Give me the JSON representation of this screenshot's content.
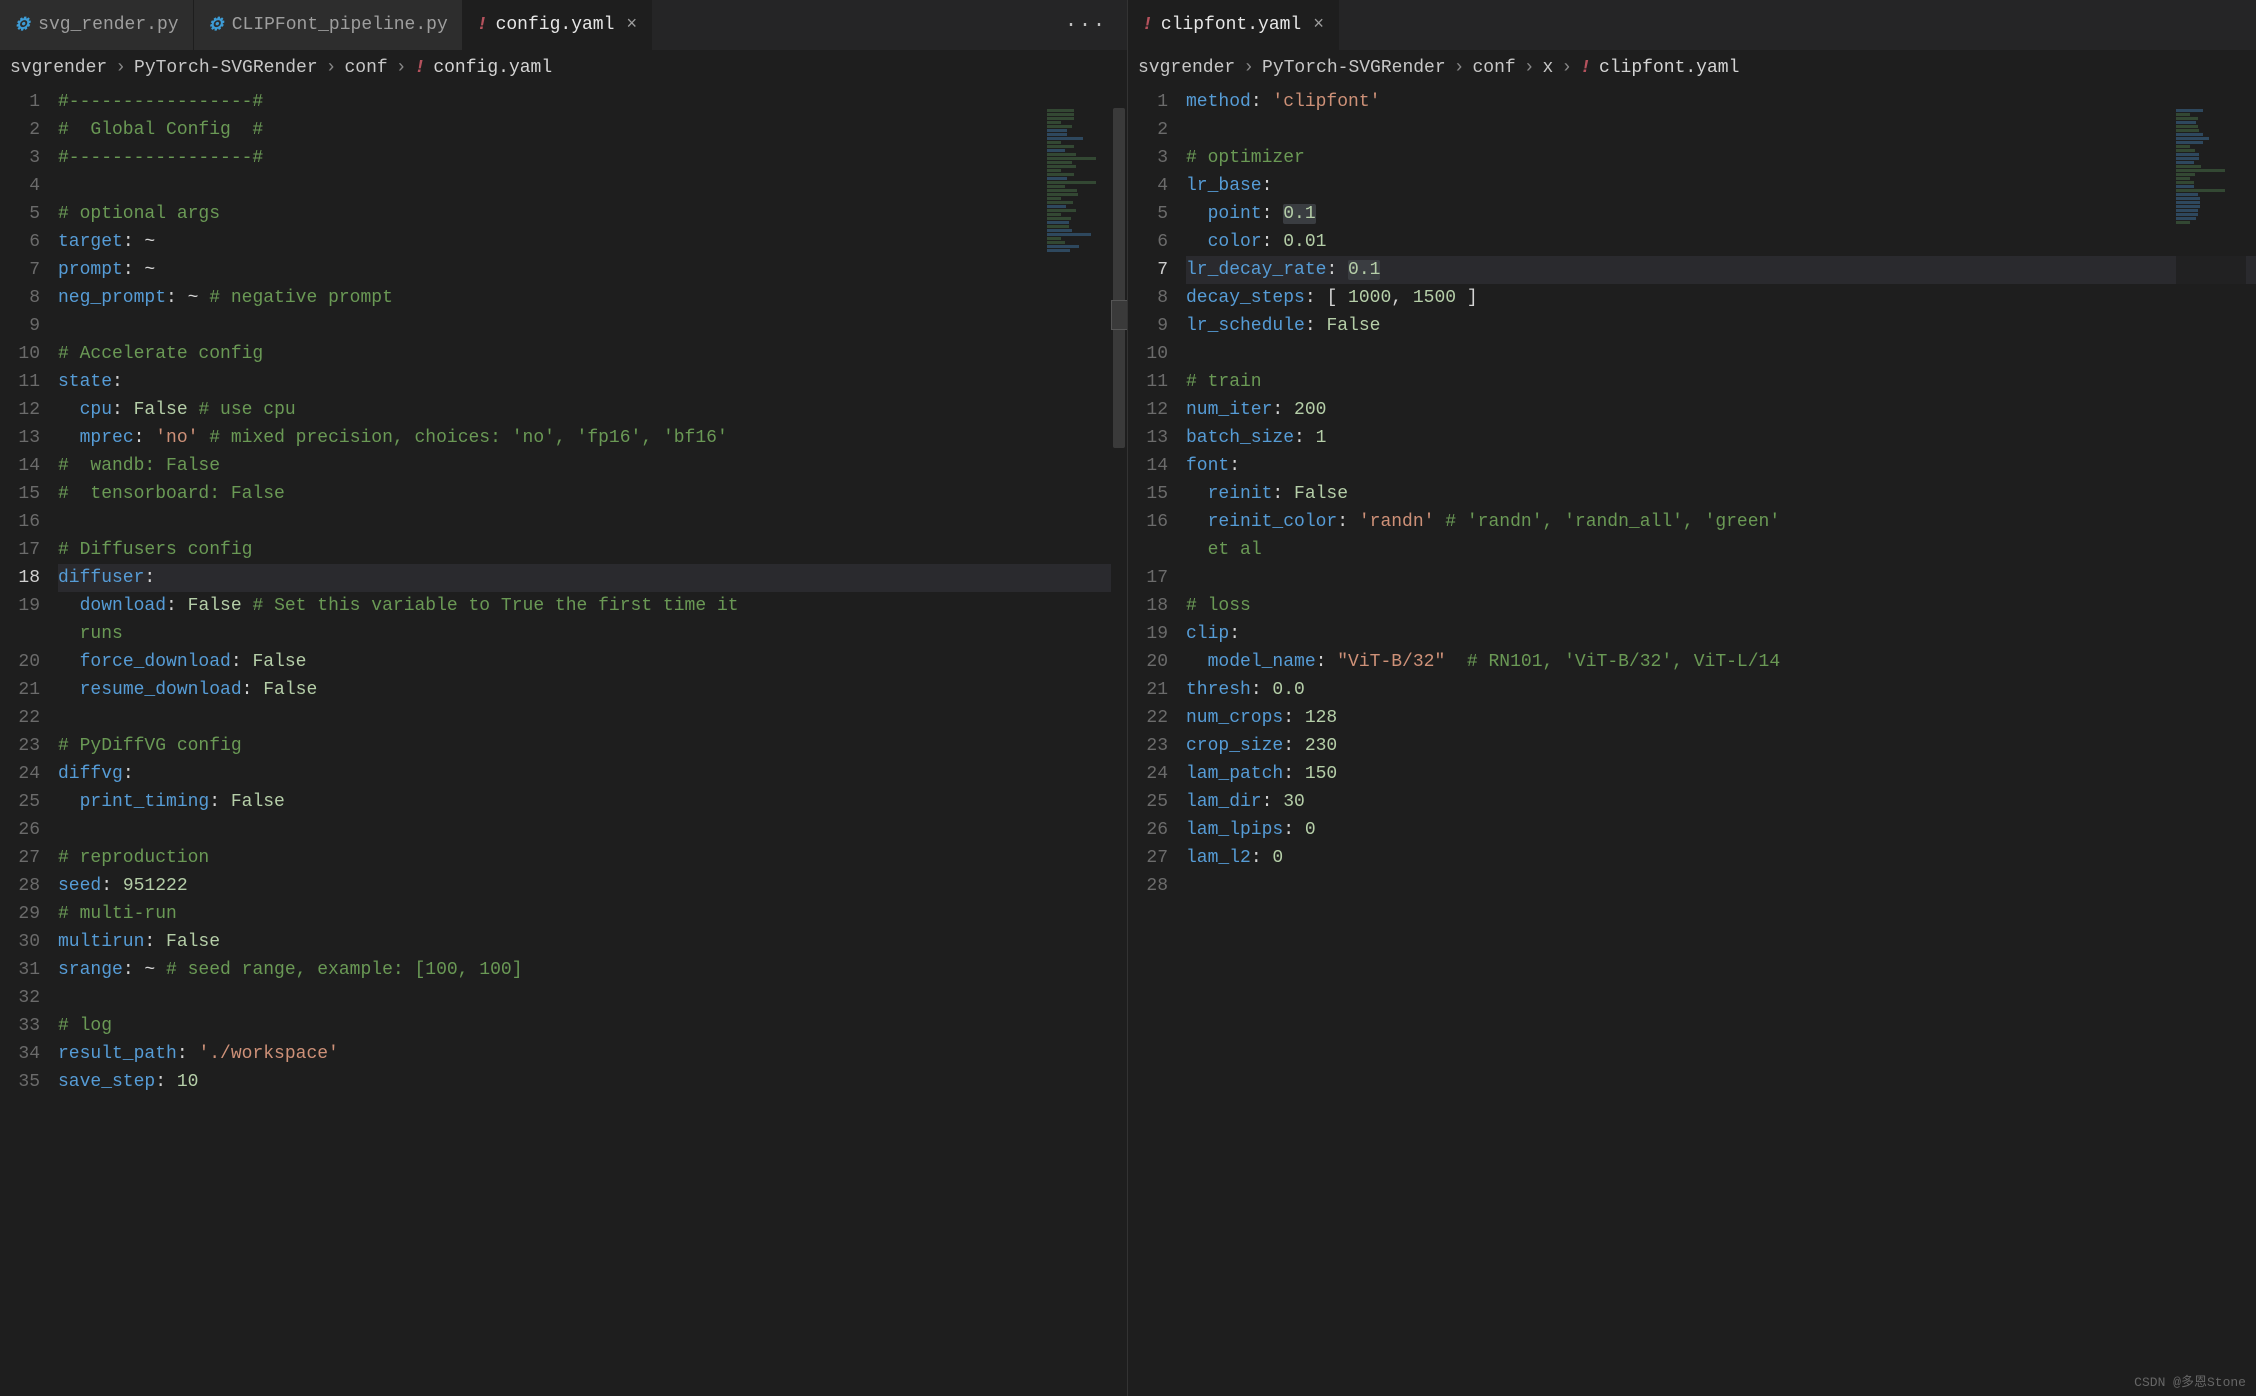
{
  "watermark": "CSDN @多恩Stone",
  "left": {
    "tabs": [
      {
        "icon": "py",
        "name": "svg_render.py",
        "active": false,
        "close": false
      },
      {
        "icon": "py",
        "name": "CLIPFont_pipeline.py",
        "active": false,
        "close": false
      },
      {
        "icon": "yaml",
        "name": "config.yaml",
        "active": true,
        "close": true
      }
    ],
    "actions": "···",
    "breadcrumb": [
      "svgrender",
      "PyTorch-SVGRender",
      "conf"
    ],
    "leaf": "config.yaml",
    "code": [
      [
        [
          "c",
          "#-----------------#"
        ]
      ],
      [
        [
          "c",
          "#  Global Config  #"
        ]
      ],
      [
        [
          "c",
          "#-----------------#"
        ]
      ],
      [],
      [
        [
          "c",
          "# optional args"
        ]
      ],
      [
        [
          "k",
          "target"
        ],
        [
          "p",
          ": "
        ],
        [
          "p",
          "~"
        ]
      ],
      [
        [
          "k",
          "prompt"
        ],
        [
          "p",
          ": "
        ],
        [
          "p",
          "~"
        ]
      ],
      [
        [
          "k",
          "neg_prompt"
        ],
        [
          "p",
          ": "
        ],
        [
          "p",
          "~ "
        ],
        [
          "c",
          "# negative prompt"
        ]
      ],
      [],
      [
        [
          "c",
          "# Accelerate config"
        ]
      ],
      [
        [
          "k",
          "state"
        ],
        [
          "p",
          ":"
        ]
      ],
      [
        [
          "p",
          "  "
        ],
        [
          "k",
          "cpu"
        ],
        [
          "p",
          ": "
        ],
        [
          "n",
          "False"
        ],
        [
          "p",
          " "
        ],
        [
          "c",
          "# use cpu"
        ]
      ],
      [
        [
          "p",
          "  "
        ],
        [
          "k",
          "mprec"
        ],
        [
          "p",
          ": "
        ],
        [
          "s",
          "'no'"
        ],
        [
          "p",
          " "
        ],
        [
          "c",
          "# mixed precision, choices: 'no', 'fp16', 'bf16'"
        ]
      ],
      [
        [
          "c",
          "#  wandb: False"
        ]
      ],
      [
        [
          "c",
          "#  tensorboard: False"
        ]
      ],
      [],
      [
        [
          "c",
          "# Diffusers config"
        ]
      ],
      [
        [
          "k",
          "diffuser"
        ],
        [
          "p",
          ":"
        ]
      ],
      [
        [
          "p",
          "  "
        ],
        [
          "k",
          "download"
        ],
        [
          "p",
          ": "
        ],
        [
          "n",
          "False"
        ],
        [
          "p",
          " "
        ],
        [
          "c",
          "# Set this variable to True the first time it "
        ]
      ],
      [
        [
          "p",
          "  "
        ],
        [
          "c",
          "runs"
        ]
      ],
      [
        [
          "p",
          "  "
        ],
        [
          "k",
          "force_download"
        ],
        [
          "p",
          ": "
        ],
        [
          "n",
          "False"
        ]
      ],
      [
        [
          "p",
          "  "
        ],
        [
          "k",
          "resume_download"
        ],
        [
          "p",
          ": "
        ],
        [
          "n",
          "False"
        ]
      ],
      [],
      [
        [
          "c",
          "# PyDiffVG config"
        ]
      ],
      [
        [
          "k",
          "diffvg"
        ],
        [
          "p",
          ":"
        ]
      ],
      [
        [
          "p",
          "  "
        ],
        [
          "k",
          "print_timing"
        ],
        [
          "p",
          ": "
        ],
        [
          "n",
          "False"
        ]
      ],
      [],
      [
        [
          "c",
          "# reproduction"
        ]
      ],
      [
        [
          "k",
          "seed"
        ],
        [
          "p",
          ": "
        ],
        [
          "n",
          "951222"
        ]
      ],
      [
        [
          "c",
          "# multi-run"
        ]
      ],
      [
        [
          "k",
          "multirun"
        ],
        [
          "p",
          ": "
        ],
        [
          "n",
          "False"
        ]
      ],
      [
        [
          "k",
          "srange"
        ],
        [
          "p",
          ": "
        ],
        [
          "p",
          "~ "
        ],
        [
          "c",
          "# seed range, example: [100, 100]"
        ]
      ],
      [],
      [
        [
          "c",
          "# log"
        ]
      ],
      [
        [
          "k",
          "result_path"
        ],
        [
          "p",
          ": "
        ],
        [
          "s",
          "'./workspace'"
        ]
      ],
      [
        [
          "k",
          "save_step"
        ],
        [
          "p",
          ": "
        ],
        [
          "n",
          "10"
        ]
      ]
    ],
    "start_line": 1,
    "current_line": 18,
    "wrap_after": 19
  },
  "right": {
    "tabs": [
      {
        "icon": "yaml",
        "name": "clipfont.yaml",
        "active": true,
        "close": true
      }
    ],
    "breadcrumb": [
      "svgrender",
      "PyTorch-SVGRender",
      "conf",
      "x"
    ],
    "leaf": "clipfont.yaml",
    "code": [
      [
        [
          "k",
          "method"
        ],
        [
          "p",
          ": "
        ],
        [
          "s",
          "'clipfont'"
        ]
      ],
      [],
      [
        [
          "c",
          "# optimizer"
        ]
      ],
      [
        [
          "k",
          "lr_base"
        ],
        [
          "p",
          ":"
        ]
      ],
      [
        [
          "p",
          "  "
        ],
        [
          "k",
          "point"
        ],
        [
          "p",
          ": "
        ],
        [
          "hl",
          "0.1"
        ]
      ],
      [
        [
          "p",
          "  "
        ],
        [
          "k",
          "color"
        ],
        [
          "p",
          ": "
        ],
        [
          "n",
          "0.01"
        ]
      ],
      [
        [
          "k",
          "lr_decay_rate"
        ],
        [
          "p",
          ": "
        ],
        [
          "hl",
          "0.1"
        ]
      ],
      [
        [
          "k",
          "decay_steps"
        ],
        [
          "p",
          ": "
        ],
        [
          "p",
          "[ "
        ],
        [
          "n",
          "1000"
        ],
        [
          "p",
          ", "
        ],
        [
          "n",
          "1500"
        ],
        [
          "p",
          " ]"
        ]
      ],
      [
        [
          "k",
          "lr_schedule"
        ],
        [
          "p",
          ": "
        ],
        [
          "n",
          "False"
        ]
      ],
      [],
      [
        [
          "c",
          "# train"
        ]
      ],
      [
        [
          "k",
          "num_iter"
        ],
        [
          "p",
          ": "
        ],
        [
          "n",
          "200"
        ]
      ],
      [
        [
          "k",
          "batch_size"
        ],
        [
          "p",
          ": "
        ],
        [
          "n",
          "1"
        ]
      ],
      [
        [
          "k",
          "font"
        ],
        [
          "p",
          ":"
        ]
      ],
      [
        [
          "p",
          "  "
        ],
        [
          "k",
          "reinit"
        ],
        [
          "p",
          ": "
        ],
        [
          "n",
          "False"
        ]
      ],
      [
        [
          "p",
          "  "
        ],
        [
          "k",
          "reinit_color"
        ],
        [
          "p",
          ": "
        ],
        [
          "s",
          "'randn'"
        ],
        [
          "p",
          " "
        ],
        [
          "c",
          "# 'randn', 'randn_all', 'green' "
        ]
      ],
      [
        [
          "p",
          "  "
        ],
        [
          "c",
          "et al"
        ]
      ],
      [],
      [
        [
          "c",
          "# loss"
        ]
      ],
      [
        [
          "k",
          "clip"
        ],
        [
          "p",
          ":"
        ]
      ],
      [
        [
          "p",
          "  "
        ],
        [
          "k",
          "model_name"
        ],
        [
          "p",
          ": "
        ],
        [
          "s",
          "\"ViT-B/32\""
        ],
        [
          "p",
          "  "
        ],
        [
          "c",
          "# RN101, 'ViT-B/32', ViT-L/14"
        ]
      ],
      [
        [
          "k",
          "thresh"
        ],
        [
          "p",
          ": "
        ],
        [
          "n",
          "0.0"
        ]
      ],
      [
        [
          "k",
          "num_crops"
        ],
        [
          "p",
          ": "
        ],
        [
          "n",
          "128"
        ]
      ],
      [
        [
          "k",
          "crop_size"
        ],
        [
          "p",
          ": "
        ],
        [
          "n",
          "230"
        ]
      ],
      [
        [
          "k",
          "lam_patch"
        ],
        [
          "p",
          ": "
        ],
        [
          "n",
          "150"
        ]
      ],
      [
        [
          "k",
          "lam_dir"
        ],
        [
          "p",
          ": "
        ],
        [
          "n",
          "30"
        ]
      ],
      [
        [
          "k",
          "lam_lpips"
        ],
        [
          "p",
          ": "
        ],
        [
          "n",
          "0"
        ]
      ],
      [
        [
          "k",
          "lam_l2"
        ],
        [
          "p",
          ": "
        ],
        [
          "n",
          "0"
        ]
      ],
      []
    ],
    "start_line": 1,
    "current_line": 7,
    "wrap_after": 16
  },
  "chart_data": null
}
